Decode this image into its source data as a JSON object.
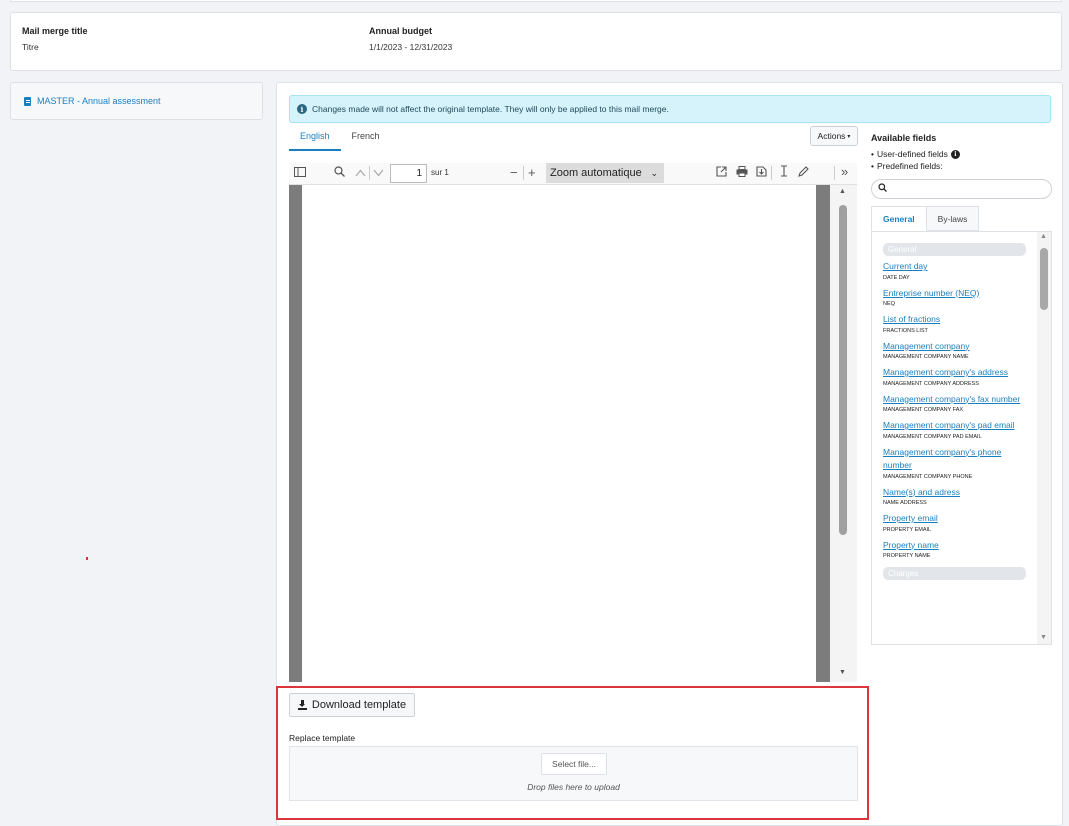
{
  "header": {
    "mail_merge_title_label": "Mail merge title",
    "mail_merge_title_value": "Titre",
    "annual_budget_label": "Annual budget",
    "annual_budget_value": "1/1/2023 - 12/31/2023"
  },
  "sidebar": {
    "item_label": "MASTER - Annual assessment"
  },
  "banner": {
    "icon": "info-icon",
    "text": "Changes made will not affect the original template. They will only be applied to this mail merge."
  },
  "tabs": [
    {
      "label": "English",
      "active": true
    },
    {
      "label": "French",
      "active": false
    }
  ],
  "actions_label": "Actions",
  "pdf_viewer": {
    "page_number": "1",
    "page_of": "sur 1",
    "zoom": "Zoom automatique"
  },
  "fields_panel": {
    "title": "Available fields",
    "user_defined": "User-defined fields",
    "predefined": "Predefined fields:",
    "tabs": [
      "General",
      "By-laws"
    ],
    "group_general": "General",
    "group_charges": "Charges",
    "fields": [
      {
        "label": "Current day",
        "code": "DATE DAY"
      },
      {
        "label": "Entreprise number (NEQ)",
        "code": "NEQ"
      },
      {
        "label": "List of fractions",
        "code": "FRACTIONS LIST"
      },
      {
        "label": "Management company",
        "code": "MANAGEMENT COMPANY NAME"
      },
      {
        "label": "Management company's address",
        "code": "MANAGEMENT COMPANY ADDRESS"
      },
      {
        "label": "Management company's fax number",
        "code": "MANAGEMENT COMPANY FAX"
      },
      {
        "label": "Management company's pad email",
        "code": "MANAGEMENT COMPANY PAD EMAIL"
      },
      {
        "label": "Management company's phone number",
        "code": "MANAGEMENT COMPANY PHONE"
      },
      {
        "label": "Name(s) and adress",
        "code": "NAME ADDRESS"
      },
      {
        "label": "Property email",
        "code": "PROPERTY EMAIL"
      },
      {
        "label": "Property name",
        "code": "PROPERTY NAME"
      }
    ]
  },
  "upload": {
    "download_label": "Download template",
    "replace_label": "Replace template",
    "select_file_label": "Select file...",
    "drop_hint": "Drop files here to upload"
  },
  "colors": {
    "accent": "#1a7fc1",
    "banner_bg": "#d6f3fb",
    "highlight_border": "#e0343d"
  }
}
